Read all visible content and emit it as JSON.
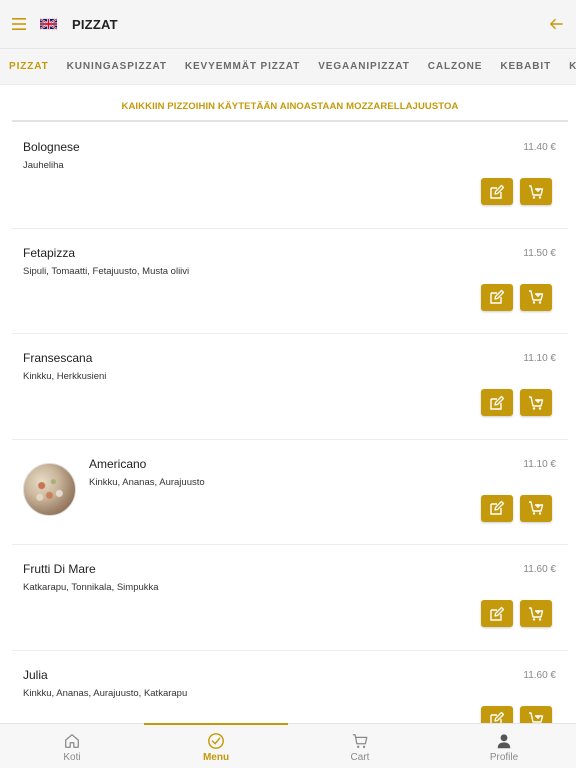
{
  "header": {
    "title": "PIZZAT",
    "language_flag": "uk-flag-icon",
    "menu_icon": "hamburger-icon",
    "back_icon": "arrow-left-icon"
  },
  "tabs": [
    {
      "label": "PIZZAT",
      "active": true
    },
    {
      "label": "KUNINGASPIZZAT",
      "active": false
    },
    {
      "label": "KEVYEMMÄT PIZZAT",
      "active": false
    },
    {
      "label": "VEGAANIPIZZAT",
      "active": false
    },
    {
      "label": "CALZONE",
      "active": false
    },
    {
      "label": "KEBABIT",
      "active": false
    },
    {
      "label": "KANA",
      "active": false
    }
  ],
  "banner": "KAIKKIIN PIZZOIHIN KÄYTETÄÄN AINOASTAAN MOZZARELLAJUUSTOA",
  "items": [
    {
      "name": "Bolognese",
      "desc": "Jauheliha",
      "price": "11.40 €"
    },
    {
      "name": "Fetapizza",
      "desc": "Sipuli, Tomaatti, Fetajuusto, Musta oliivi",
      "price": "11.50 €"
    },
    {
      "name": "Fransescana",
      "desc": "Kinkku, Herkkusieni",
      "price": "11.10 €"
    },
    {
      "name": "Americano",
      "desc": "Kinkku, Ananas, Aurajuusto",
      "price": "11.10 €"
    },
    {
      "name": "Frutti Di Mare",
      "desc": "Katkarapu, Tonnikala, Simpukka",
      "price": "11.60 €"
    },
    {
      "name": "Julia",
      "desc": "Kinkku, Ananas, Aurajuusto, Katkarapu",
      "price": "11.60 €"
    }
  ],
  "bottom_nav": [
    {
      "label": "Koti",
      "icon": "home-icon",
      "active": false
    },
    {
      "label": "Menu",
      "icon": "check-circle-icon",
      "active": true
    },
    {
      "label": "Cart",
      "icon": "cart-icon",
      "active": false
    },
    {
      "label": "Profile",
      "icon": "person-icon",
      "active": false
    }
  ],
  "colors": {
    "accent": "#c49a0c",
    "header_bg": "#f5f5f5",
    "text_muted": "#888888"
  }
}
